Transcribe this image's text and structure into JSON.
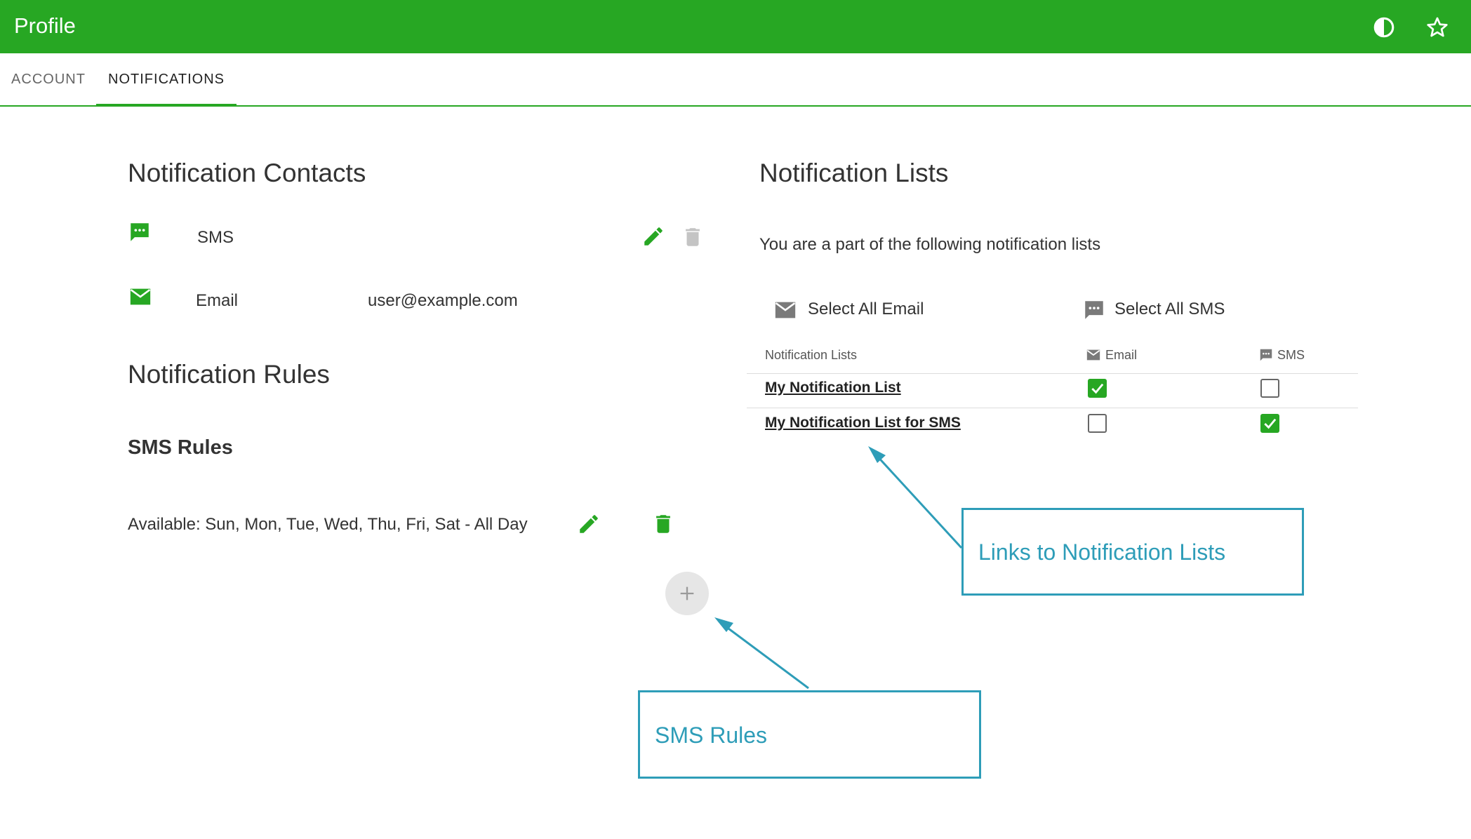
{
  "header": {
    "title": "Profile",
    "contrast_icon": "contrast-icon",
    "favorite_icon": "star-outline-icon"
  },
  "tabs": [
    {
      "label": "ACCOUNT",
      "active": false
    },
    {
      "label": "NOTIFICATIONS",
      "active": true
    }
  ],
  "contacts": {
    "title": "Notification Contacts",
    "items": [
      {
        "type": "SMS",
        "value": "",
        "icon": "sms-icon"
      },
      {
        "type": "Email",
        "value": "user@example.com",
        "icon": "email-icon"
      }
    ]
  },
  "rules": {
    "title": "Notification Rules",
    "sms_title": "SMS Rules",
    "items": [
      {
        "text": "Available: Sun, Mon, Tue, Wed, Thu, Fri, Sat - All Day"
      }
    ]
  },
  "lists": {
    "title": "Notification Lists",
    "description": "You are a part of the following notification lists",
    "select_all_email": "Select All Email",
    "select_all_sms": "Select All SMS",
    "columns": [
      "Notification Lists",
      "Email",
      "SMS"
    ],
    "rows": [
      {
        "name": "My Notification List",
        "email": true,
        "sms": false
      },
      {
        "name": "My Notification List for SMS",
        "email": false,
        "sms": true
      }
    ]
  },
  "callouts": {
    "lists_link": "Links to Notification Lists",
    "sms_rules": "SMS Rules"
  },
  "colors": {
    "brand": "#27a723",
    "callout": "#2e9db8",
    "disabled": "#c4c4c4"
  }
}
